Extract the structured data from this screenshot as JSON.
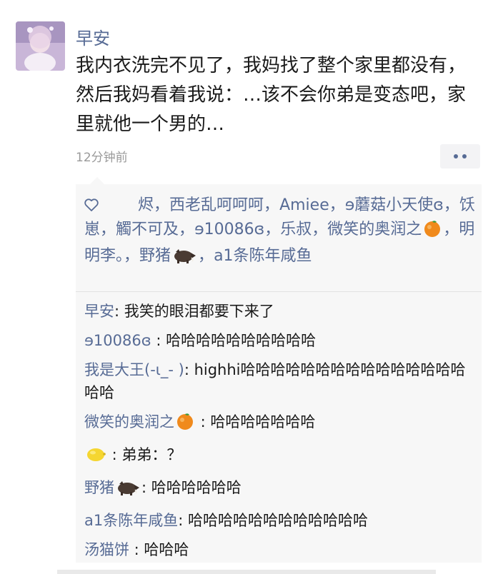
{
  "post": {
    "author": "早安",
    "text": "我内衣洗完不见了，我妈找了整个家里都没有，然后我妈看着我说：…该不会你弟是变态吧，家里就他一个男的…",
    "time": "12分钟前"
  },
  "likes": {
    "icon": "heart-icon",
    "names": [
      {
        "text": "烬",
        "sep": "，"
      },
      {
        "text": "西老乱呵呵呵",
        "sep": "，"
      },
      {
        "text": "Amiee",
        "sep": "，"
      },
      {
        "text": "ɘ蘑菇小天使ɞ",
        "sep": "，"
      },
      {
        "text": "饫崽",
        "sep": "，"
      },
      {
        "text": "觸不可及",
        "sep": "，"
      },
      {
        "text": "ɘ10086ɞ",
        "sep": "，"
      },
      {
        "text": "乐叔",
        "sep": "，"
      },
      {
        "text": "微笑的奥润之",
        "emoji": "orange-emoji",
        "sep": "，"
      },
      {
        "text": "明明李。",
        "sep": "，"
      },
      {
        "text": "野猪",
        "emoji": "boar-emoji",
        "sep": "，"
      },
      {
        "text": "a1条陈年咸鱼",
        "sep": ""
      }
    ]
  },
  "comments": [
    {
      "name": "早安",
      "text": ": 我笑的眼泪都要下来了"
    },
    {
      "name": "ɘ10086ɞ",
      "text": " : 哈哈哈哈哈哈哈哈哈哈"
    },
    {
      "name": "我是大王(-ι_- )",
      "text": ": highhi哈哈哈哈哈哈哈哈哈哈哈哈哈哈哈哈哈"
    },
    {
      "name": "微笑的奥润之",
      "emoji": "orange-emoji",
      "text": " : 哈哈哈哈哈哈哈"
    },
    {
      "name": "",
      "emoji": "lemon-emoji",
      "text": " : 弟弟：？"
    },
    {
      "name": "野猪",
      "emoji": "boar-emoji",
      "text": ": 哈哈哈哈哈哈"
    },
    {
      "name": "a1条陈年咸鱼",
      "text": ": 哈哈哈哈哈哈哈哈哈哈哈哈"
    },
    {
      "name": "汤猫饼",
      "text": " : 哈哈哈"
    }
  ],
  "colors": {
    "link": "#576b95",
    "text": "#1a1a1a",
    "time": "#9a9a9a",
    "panel": "#f7f7f7"
  }
}
